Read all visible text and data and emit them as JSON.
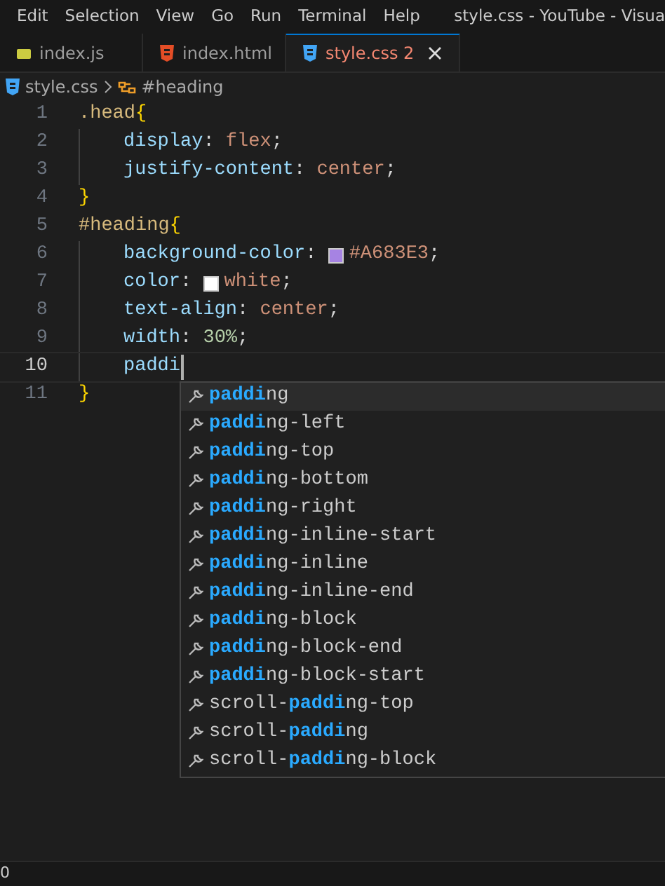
{
  "menu": [
    {
      "label": "Edit"
    },
    {
      "label": "Selection"
    },
    {
      "label": "View"
    },
    {
      "label": "Go"
    },
    {
      "label": "Run"
    },
    {
      "label": "Terminal"
    },
    {
      "label": "Help"
    }
  ],
  "window_title": "style.css - YouTube - Visua",
  "tabs": [
    {
      "label": "index.js",
      "kind": "js",
      "selected": false
    },
    {
      "label": "index.html",
      "kind": "html",
      "selected": false
    },
    {
      "label": "style.css",
      "kind": "css",
      "selected": true,
      "problems": "2"
    }
  ],
  "breadcrumbs": [
    {
      "label": "style.css",
      "kind": "file"
    },
    {
      "label": "#heading",
      "kind": "symbol"
    }
  ],
  "editor": {
    "lines": [
      {
        "number": "1",
        "indented": false,
        "current": false,
        "tokens": [
          {
            "text": ".head",
            "kind": "selector"
          },
          {
            "text": "{",
            "kind": "brace"
          }
        ]
      },
      {
        "number": "2",
        "indented": true,
        "current": false,
        "tokens": [
          {
            "text": "display",
            "kind": "property"
          },
          {
            "text": ": ",
            "kind": "punct"
          },
          {
            "text": "flex",
            "kind": "value"
          },
          {
            "text": ";",
            "kind": "punct"
          }
        ]
      },
      {
        "number": "3",
        "indented": true,
        "current": false,
        "tokens": [
          {
            "text": "justify-content",
            "kind": "property"
          },
          {
            "text": ": ",
            "kind": "punct"
          },
          {
            "text": "center",
            "kind": "value"
          },
          {
            "text": ";",
            "kind": "punct"
          }
        ]
      },
      {
        "number": "4",
        "indented": false,
        "current": false,
        "tokens": [
          {
            "text": "}",
            "kind": "brace"
          }
        ]
      },
      {
        "number": "5",
        "indented": false,
        "current": false,
        "tokens": [
          {
            "text": "#heading",
            "kind": "selector"
          },
          {
            "text": "{",
            "kind": "brace"
          }
        ]
      },
      {
        "number": "6",
        "indented": true,
        "current": false,
        "tokens": [
          {
            "text": "background-color",
            "kind": "property"
          },
          {
            "text": ": ",
            "kind": "punct"
          },
          {
            "kind": "swatch",
            "color": "#a683e3"
          },
          {
            "text": "#A683E3",
            "kind": "value"
          },
          {
            "text": ";",
            "kind": "punct"
          }
        ]
      },
      {
        "number": "7",
        "indented": true,
        "current": false,
        "tokens": [
          {
            "text": "color",
            "kind": "property"
          },
          {
            "text": ": ",
            "kind": "punct"
          },
          {
            "kind": "swatch",
            "color": "#ffffff"
          },
          {
            "text": "white",
            "kind": "value"
          },
          {
            "text": ";",
            "kind": "punct"
          }
        ]
      },
      {
        "number": "8",
        "indented": true,
        "current": false,
        "tokens": [
          {
            "text": "text-align",
            "kind": "property"
          },
          {
            "text": ": ",
            "kind": "punct"
          },
          {
            "text": "center",
            "kind": "value"
          },
          {
            "text": ";",
            "kind": "punct"
          }
        ]
      },
      {
        "number": "9",
        "indented": true,
        "current": false,
        "tokens": [
          {
            "text": "width",
            "kind": "property"
          },
          {
            "text": ": ",
            "kind": "punct"
          },
          {
            "text": "30%",
            "kind": "number"
          },
          {
            "text": ";",
            "kind": "punct"
          }
        ]
      },
      {
        "number": "10",
        "indented": true,
        "current": true,
        "tokens": [
          {
            "text": "paddi",
            "kind": "property"
          }
        ]
      },
      {
        "number": "11",
        "indented": false,
        "current": false,
        "tokens": [
          {
            "text": "}",
            "kind": "brace"
          }
        ]
      }
    ]
  },
  "suggestions": [
    {
      "match": "paddi",
      "after": "ng",
      "selected": true
    },
    {
      "match": "paddi",
      "after": "ng-left",
      "selected": false
    },
    {
      "match": "paddi",
      "after": "ng-top",
      "selected": false
    },
    {
      "match": "paddi",
      "after": "ng-bottom",
      "selected": false
    },
    {
      "match": "paddi",
      "after": "ng-right",
      "selected": false
    },
    {
      "match": "paddi",
      "after": "ng-inline-start",
      "selected": false
    },
    {
      "match": "paddi",
      "after": "ng-inline",
      "selected": false
    },
    {
      "match": "paddi",
      "after": "ng-inline-end",
      "selected": false
    },
    {
      "match": "paddi",
      "after": "ng-block",
      "selected": false
    },
    {
      "match": "paddi",
      "after": "ng-block-end",
      "selected": false
    },
    {
      "match": "paddi",
      "after": "ng-block-start",
      "selected": false
    },
    {
      "before": "scroll-",
      "match": "paddi",
      "after": "ng-top",
      "selected": false
    },
    {
      "before": "scroll-",
      "match": "paddi",
      "after": "ng",
      "selected": false
    },
    {
      "before": "scroll-",
      "match": "paddi",
      "after": "ng-block",
      "selected": false
    }
  ],
  "status_bar": {
    "text": "0"
  }
}
